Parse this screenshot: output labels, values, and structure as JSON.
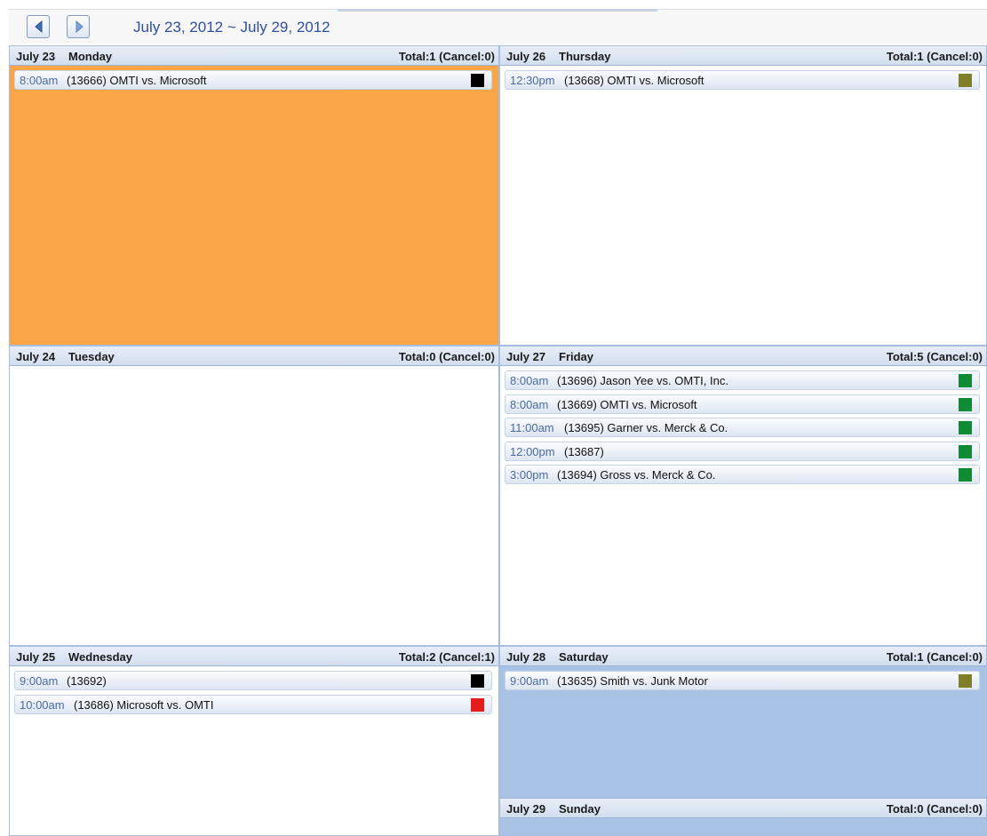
{
  "toolbar": {
    "prev_icon": "triangle-left-icon",
    "next_icon": "triangle-right-icon",
    "range_title": "July 23, 2012 ~ July 29, 2012"
  },
  "days": [
    {
      "date": "July 23",
      "weekday": "Monday",
      "total": "Total:1 (Cancel:0)",
      "background": "#f9a647",
      "events": [
        {
          "time": "8:00am",
          "title": "(13666) OMTI vs. Microsoft",
          "color": "#000000"
        }
      ]
    },
    {
      "date": "July 24",
      "weekday": "Tuesday",
      "total": "Total:0 (Cancel:0)",
      "background": "#ffffff",
      "events": []
    },
    {
      "date": "July 25",
      "weekday": "Wednesday",
      "total": "Total:2 (Cancel:1)",
      "background": "#ffffff",
      "events": [
        {
          "time": "9:00am",
          "title": "(13692)",
          "color": "#000000"
        },
        {
          "time": "10:00am",
          "title": "(13686) Microsoft vs. OMTI",
          "color": "#e51c1c"
        }
      ]
    },
    {
      "date": "July 26",
      "weekday": "Thursday",
      "total": "Total:1 (Cancel:0)",
      "background": "#ffffff",
      "events": [
        {
          "time": "12:30pm",
          "title": "(13668) OMTI vs. Microsoft",
          "color": "#7f7f2a"
        }
      ]
    },
    {
      "date": "July 27",
      "weekday": "Friday",
      "total": "Total:5 (Cancel:0)",
      "background": "#ffffff",
      "events": [
        {
          "time": "8:00am",
          "title": "(13696) Jason Yee vs. OMTI, Inc.",
          "color": "#0f8a35"
        },
        {
          "time": "8:00am",
          "title": "(13669) OMTI vs. Microsoft",
          "color": "#0f8a35"
        },
        {
          "time": "11:00am",
          "title": "(13695) Garner vs. Merck & Co.",
          "color": "#0f8a35"
        },
        {
          "time": "12:00pm",
          "title": "(13687)",
          "color": "#0f8a35"
        },
        {
          "time": "3:00pm",
          "title": "(13694) Gross vs. Merck & Co.",
          "color": "#0f8a35"
        }
      ]
    },
    {
      "date": "July 28",
      "weekday": "Saturday",
      "total": "Total:1 (Cancel:0)",
      "background": "#a9c3e6",
      "events": [
        {
          "time": "9:00am",
          "title": "(13635) Smith vs. Junk Motor",
          "color": "#7f7f2a"
        }
      ]
    },
    {
      "date": "July 29",
      "weekday": "Sunday",
      "total": "Total:0 (Cancel:0)",
      "background": "#a9c3e6",
      "events": []
    }
  ]
}
